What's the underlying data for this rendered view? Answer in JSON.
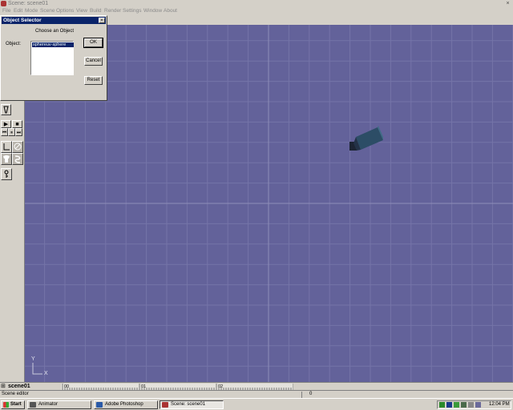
{
  "window": {
    "title": "Scene: scene01",
    "close_glyph": "×"
  },
  "menu": {
    "items": [
      "File",
      "Edit",
      "Mode",
      "Scene",
      "Options",
      "View",
      "Build",
      "Render",
      "Settings",
      "Window",
      "About"
    ]
  },
  "dialog": {
    "title": "Object Selector",
    "close_glyph": "×",
    "prompt": "Choose an Object",
    "object_label": "Object:",
    "list_items": [
      "sphereuv-sphere"
    ],
    "ok_label": "OK",
    "cancel_label": "Cancel",
    "reset_label": "Reset"
  },
  "tools": {
    "play_glyph": "▶",
    "stop_glyph": "■",
    "rewind_glyph": "⏮",
    "pause_glyph": "⏸",
    "forward_glyph": "⏭"
  },
  "viewport": {
    "axis_y": "Y",
    "axis_x": "X"
  },
  "scenebar": {
    "label": "scene01",
    "frame_labels": [
      "00",
      "01",
      "02"
    ]
  },
  "statusbar": {
    "text": "Scene editor",
    "value": "0"
  },
  "taskbar": {
    "start_label": "Start",
    "tasks": [
      {
        "label": "Animator",
        "icon": "animator-icon"
      },
      {
        "label": "Adobe Photoshop",
        "icon": "photoshop-icon"
      },
      {
        "label": "Scene: scene01",
        "icon": "scene-icon"
      }
    ],
    "clock": "12:04 PM"
  },
  "colors": {
    "viewport_bg": "#63629a",
    "grid_line": "#7574a8",
    "axis_line": "#8e8db8",
    "dialog_title_bg": "#0a246a",
    "object_dark": "#1f2e44",
    "object_light": "#2f5870"
  }
}
